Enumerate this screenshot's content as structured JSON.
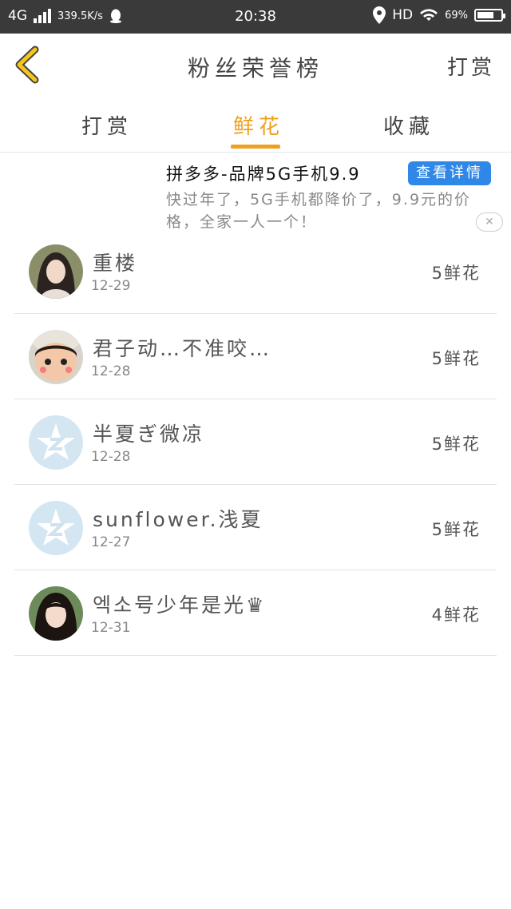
{
  "status_bar": {
    "network": "4G",
    "speed": "339.5K/s",
    "time": "20:38",
    "hd": "HD",
    "battery": "69%"
  },
  "header": {
    "title": "粉丝荣誉榜",
    "action_label": "打赏"
  },
  "tabs": [
    {
      "label": "打赏",
      "active": false
    },
    {
      "label": "鲜花",
      "active": true
    },
    {
      "label": "收藏",
      "active": false
    }
  ],
  "ad": {
    "title": "拼多多-品牌5G手机9.9",
    "button_label": "查看详情",
    "description": "快过年了，5G手机都降价了，9.9元的价格，全家一人一个！"
  },
  "fans": [
    {
      "name": "重楼",
      "date": "12-29",
      "count": "5鲜花",
      "avatar": "girl-portrait"
    },
    {
      "name": "君子动…不准咬…",
      "date": "12-28",
      "count": "5鲜花",
      "avatar": "doll-face"
    },
    {
      "name": "半夏ぎ微凉",
      "date": "12-28",
      "count": "5鲜花",
      "avatar": "qzone-default"
    },
    {
      "name": "sunflower.浅夏",
      "date": "12-27",
      "count": "5鲜花",
      "avatar": "qzone-default"
    },
    {
      "name": "엑소号少年是光♛",
      "date": "12-31",
      "count": "4鲜花",
      "avatar": "girl-portrait-2"
    }
  ],
  "colors": {
    "accent": "#f0a01e",
    "ad_button": "#2f87e8",
    "status_bar": "#3a3a3a"
  }
}
